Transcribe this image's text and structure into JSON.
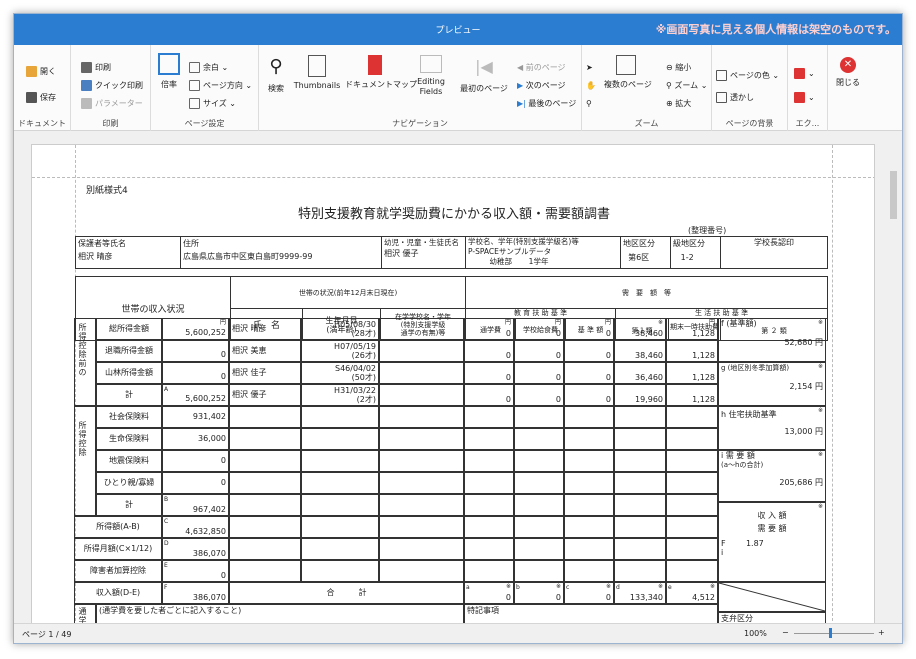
{
  "window": {
    "title": "プレビュー",
    "notice": "※画面写真に見える個人情報は架空のものです。"
  },
  "ribbon": {
    "doc": {
      "label": "ドキュメント",
      "open": "開く",
      "save": "保存"
    },
    "print": {
      "label": "印刷",
      "print": "印刷",
      "quick": "クイック印刷",
      "params": "パラメーター"
    },
    "pagesetup": {
      "label": "ページ設定",
      "scale": "倍率",
      "margin": "余白",
      "orientation": "ページ方向",
      "size": "サイズ"
    },
    "nav": {
      "label": "ナビゲーション",
      "search": "検索",
      "thumbnails": "Thumbnails",
      "docmap": "ドキュメントマップ",
      "editing": "Editing Fields",
      "first": "最初のページ",
      "prev": "前のページ",
      "next": "次のページ",
      "last": "最後のページ"
    },
    "zoom": {
      "label": "ズーム",
      "multi": "複数のページ",
      "out": "縮小",
      "zoom": "ズーム",
      "in": "拡大"
    },
    "bg": {
      "label": "ページの背景",
      "color": "ページの色",
      "watermark": "透かし"
    },
    "export": {
      "label": "エク..."
    },
    "close": {
      "label": "閉じる"
    }
  },
  "status": {
    "page": "ページ 1 / 49",
    "zoom": "100%"
  },
  "form": {
    "form_no": "別紙様式4",
    "title": "特別支援教育就学奨励費にかかる収入額・需要額調書",
    "seiri": "(整理番号)",
    "h_guardian": "保護者等氏名",
    "guardian": "相沢 晴彦",
    "h_address": "住所",
    "address": "広島県広島市中区東白島町9999-99",
    "h_child": "幼児・児童・生徒氏名",
    "child": "相沢 優子",
    "h_school": "学校名、学年(特別支援学級名)等",
    "school": "P-SPACEサンプルデータ",
    "school2": "幼稚部",
    "grade": "1学年",
    "h_area": "地区区分",
    "area": "第6区",
    "h_grade_area": "級地区分",
    "grade_area": "1-2",
    "h_principal": "学校長認印",
    "income_status": "世帯の収入状況",
    "household": "世帯の状況(前年12月末日現在)",
    "h_name": "氏　名",
    "h_birth": "生年月日",
    "h_age": "(満年齢)",
    "h_enrolled": "在学学校名・学年",
    "h_special": "(特別支援学級",
    "h_attend": "通学の有無)等",
    "demand": "需　要　額　等",
    "edu_std": "教 育 扶 助 基 準",
    "life_std": "生 活 扶 助 基 準",
    "h_commute": "通学費",
    "h_lunch": "学校給食費",
    "h_basic": "基 準 額",
    "h_class1": "第１類",
    "h_winter": "期末一時扶助費",
    "h_class2": "第 ２ 類",
    "sec1": "所得控除前の",
    "sec2": "所得控除",
    "rows": [
      {
        "label": "総所得金額",
        "val": "5,600,252",
        "name": "相沢 晴彦",
        "birth": "H05/08/30",
        "age": "(28才)",
        "c1": "0",
        "c2": "0",
        "c3": "0",
        "c4": "38,460",
        "c5": "1,128"
      },
      {
        "label": "退職所得金額",
        "val": "0",
        "name": "相沢 美恵",
        "birth": "H07/05/19",
        "age": "(26才)",
        "c1": "0",
        "c2": "0",
        "c3": "0",
        "c4": "38,460",
        "c5": "1,128"
      },
      {
        "label": "山林所得金額",
        "val": "0",
        "name": "相沢 佳子",
        "birth": "S46/04/02",
        "age": "(50才)",
        "c1": "0",
        "c2": "0",
        "c3": "0",
        "c4": "36,460",
        "c5": "1,128"
      },
      {
        "label": "計",
        "val": "5,600,252",
        "name": "相沢 優子",
        "birth": "H31/03/22",
        "age": "(2才)",
        "c1": "0",
        "c2": "0",
        "c3": "0",
        "c4": "19,960",
        "c5": "1,128"
      }
    ],
    "ded": [
      {
        "label": "社会保険料",
        "val": "931,402"
      },
      {
        "label": "生命保険料",
        "val": "36,000"
      },
      {
        "label": "地震保険料",
        "val": "0"
      },
      {
        "label": "ひとり親/寡婦",
        "val": "0"
      },
      {
        "label": "計",
        "val": "967,402"
      }
    ],
    "income_ab": {
      "label": "所得額(A-B)",
      "val": "4,632,850"
    },
    "monthly": {
      "label": "所得月額(C×1/12)",
      "val": "386,070"
    },
    "disabled": {
      "label": "障害者加算控除",
      "val": "0"
    },
    "income_de": {
      "label": "収入額(D-E)",
      "val": "386,070"
    },
    "total": "合　　　計",
    "totals": {
      "a": "0",
      "b": "0",
      "c": "0",
      "d": "133,340",
      "e": "4,512"
    },
    "f_label": "f (基準額)",
    "f_val": "52,680",
    "g_label": "g (地区別冬季加算額)",
    "g_val": "2,154",
    "h_label": "h 住宅扶助基準",
    "h_val": "13,000",
    "i_label": "i 需 要 額",
    "i_sub": "(a〜hの合計)",
    "i_val": "205,686",
    "yen": "円",
    "ratio_h1": "収 入 額",
    "ratio_h2": "需 要 額",
    "ratio_f": "F",
    "ratio_i": "i",
    "ratio": "1.87",
    "commute_note": "(通学費を要した者ごとに記入すること)",
    "commute_side": "通学費",
    "special": "特記事項",
    "support": "支弁区分",
    "marks": {
      "A": "A",
      "B": "B",
      "C": "C",
      "D": "D",
      "E": "E",
      "F": "F",
      "a": "a",
      "b": "b",
      "c": "c",
      "d": "d",
      "e": "e",
      "kome": "※"
    }
  }
}
